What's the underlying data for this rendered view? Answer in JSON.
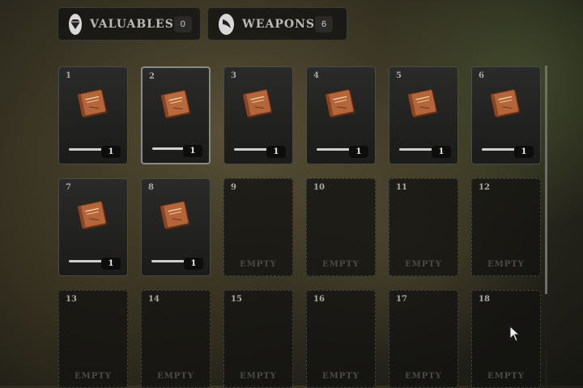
{
  "tabs": [
    {
      "label": "Valuables",
      "count": "0",
      "icon": "diamond-icon"
    },
    {
      "label": "Weapons",
      "count": "6",
      "icon": "blade-icon"
    }
  ],
  "slots": [
    {
      "num": "1",
      "filled": true,
      "qty": "1",
      "color": "#b5653a"
    },
    {
      "num": "2",
      "filled": true,
      "qty": "1",
      "color": "#b86a3c",
      "selected": true
    },
    {
      "num": "3",
      "filled": true,
      "qty": "1",
      "color": "#b5653a"
    },
    {
      "num": "4",
      "filled": true,
      "qty": "1",
      "color": "#b5653a"
    },
    {
      "num": "5",
      "filled": true,
      "qty": "1",
      "color": "#b5653a"
    },
    {
      "num": "6",
      "filled": true,
      "qty": "1",
      "color": "#b5653a"
    },
    {
      "num": "7",
      "filled": true,
      "qty": "1",
      "color": "#b5653a"
    },
    {
      "num": "8",
      "filled": true,
      "qty": "1",
      "color": "#b5653a"
    },
    {
      "num": "9",
      "filled": false,
      "empty_label": "EMPTY"
    },
    {
      "num": "10",
      "filled": false,
      "empty_label": "EMPTY"
    },
    {
      "num": "11",
      "filled": false,
      "empty_label": "EMPTY"
    },
    {
      "num": "12",
      "filled": false,
      "empty_label": "EMPTY"
    },
    {
      "num": "13",
      "filled": false,
      "empty_label": "EMPTY"
    },
    {
      "num": "14",
      "filled": false,
      "empty_label": "EMPTY"
    },
    {
      "num": "15",
      "filled": false,
      "empty_label": "EMPTY"
    },
    {
      "num": "16",
      "filled": false,
      "empty_label": "EMPTY"
    },
    {
      "num": "17",
      "filled": false,
      "empty_label": "EMPTY"
    },
    {
      "num": "18",
      "filled": false,
      "empty_label": "EMPTY"
    }
  ]
}
